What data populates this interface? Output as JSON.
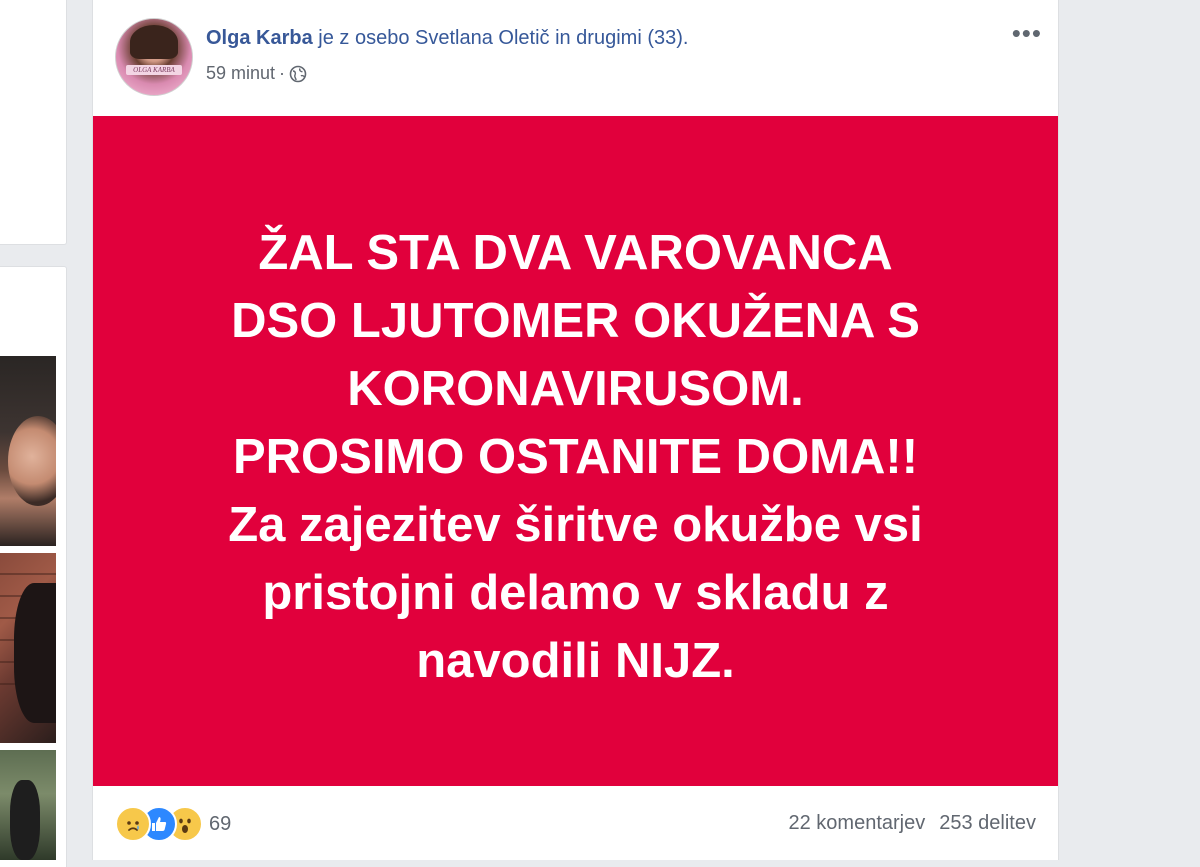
{
  "post": {
    "author": "Olga Karba",
    "header_rest": "je z osebo Svetlana Oletič in drugimi (33).",
    "time": "59 minut",
    "separator": "·",
    "more_label": "•••",
    "avatar_tag": "OLGA KARBA",
    "banner": {
      "background_color": "#e1003c",
      "text_color": "#ffffff",
      "lines": [
        "ŽAL STA DVA VAROVANCA",
        "DSO LJUTOMER OKUŽENA S",
        "KORONAVIRUSOM.",
        "PROSIMO OSTANITE DOMA!!",
        "Za zajezitev širitve okužbe vsi",
        "pristojni delamo v skladu z",
        "navodili NIJZ."
      ]
    },
    "reactions": {
      "icons": [
        "sad-icon",
        "like-icon",
        "wow-icon"
      ],
      "count": "69"
    },
    "comments": "22 komentarjev",
    "shares": "253 delitev"
  }
}
